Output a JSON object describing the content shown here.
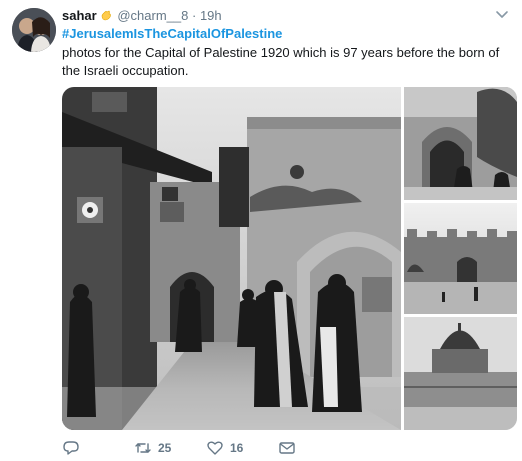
{
  "user": {
    "name": "sahar",
    "emoji": "hand-wave-emoji",
    "handle": "@charm__8",
    "separator": "·",
    "time": "19h"
  },
  "tweet": {
    "hashtag": "#JerusalemIsTheCapitalOfPalestine",
    "text": "photos for the Capital of Palestine 1920 which is 97 years before the born of the Israeli occupation."
  },
  "media": {
    "images": [
      "street-scene-photo",
      "gate-photo",
      "city-wall-photo",
      "dome-of-the-rock-photo"
    ]
  },
  "actions": {
    "reply_icon": "reply-icon",
    "retweet_icon": "retweet-icon",
    "retweet_count": "25",
    "like_icon": "heart-icon",
    "like_count": "16",
    "dm_icon": "envelope-icon"
  },
  "colors": {
    "link": "#1b95e0",
    "muted": "#657786",
    "text": "#14171a"
  }
}
